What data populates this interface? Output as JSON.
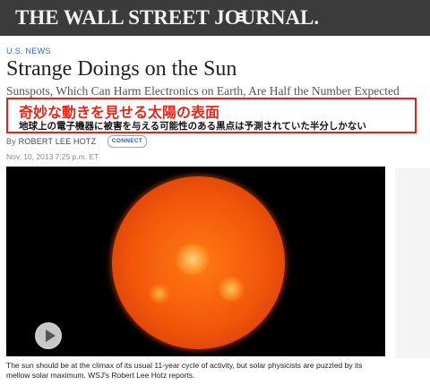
{
  "header": {
    "logo": "THE WALL STREET JOURNAL.",
    "menu_icon": "hamburger-menu-icon"
  },
  "article": {
    "section": "U.S. NEWS",
    "headline": "Strange Doings on the Sun",
    "subheadline": "Sunspots, Which Can Harm Electronics on Earth, Are Half the Number Expected",
    "byline_prefix": "By",
    "author": "ROBERT LEE HOTZ",
    "connect_label": "CONNECT",
    "timestamp": "Nov. 10, 2013 7:25 p.m. ET",
    "caption": "The sun should be at the climax of its usual 11-year cycle of activity, but solar physicists are puzzled by its mellow solar maximum. WSJ's Robert Lee Hotz reports."
  },
  "translation": {
    "title": "奇妙な動きを見せる太陽の表面",
    "subtitle": "地球上の電子機器に被害を与える可能性のある黒点は予測されていた半分しかない"
  },
  "video": {
    "play_icon": "play-icon"
  },
  "colors": {
    "masthead": "#3b3b3b",
    "link_blue": "#2a6bb8",
    "annotation_red": "#d9261c"
  }
}
